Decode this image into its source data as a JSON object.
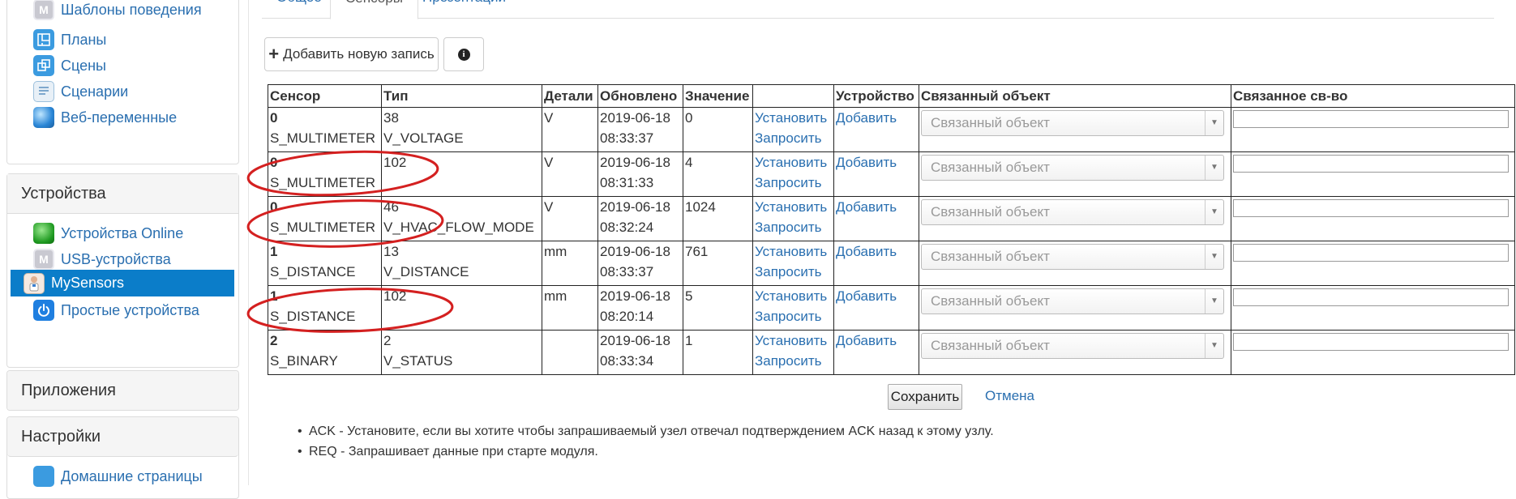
{
  "sidebar": {
    "top_items": [
      {
        "label": "Шаблоны поведения",
        "icon": "behavior-template-icon"
      },
      {
        "label": "Планы",
        "icon": "plans-icon"
      },
      {
        "label": "Сцены",
        "icon": "scenes-icon"
      },
      {
        "label": "Сценарии",
        "icon": "scripts-icon"
      },
      {
        "label": "Веб-переменные",
        "icon": "globe-icon"
      }
    ],
    "devices_header": "Устройства",
    "device_items": [
      {
        "label": "Устройства Online",
        "icon": "online-devices-icon"
      },
      {
        "label": "USB-устройства",
        "icon": "usb-devices-icon"
      },
      {
        "label": "MySensors",
        "icon": "mysensors-icon",
        "active": true
      },
      {
        "label": "Простые устройства",
        "icon": "power-icon"
      }
    ],
    "apps_header": "Приложения",
    "settings_header": "Настройки",
    "settings_partial_item": "Домашние страницы"
  },
  "tabs": [
    {
      "label": "Общее"
    },
    {
      "label": "Сенсоры",
      "active": true
    },
    {
      "label": "Презентации"
    }
  ],
  "toolbar": {
    "add_label": "Добавить новую запись",
    "info_icon": "info-icon"
  },
  "table": {
    "headers": [
      "Сенсор",
      "Тип",
      "Детали",
      "Обновлено",
      "Значение",
      "",
      "Устройство",
      "Связанный объект",
      "Связанное св-во"
    ],
    "rows": [
      {
        "sensor_id": "0",
        "sensor_type": "S_MULTIMETER",
        "type_id": "38",
        "type_name": "V_VOLTAGE",
        "details": "V",
        "date": "2019-06-18",
        "time": "08:33:37",
        "value": "0"
      },
      {
        "sensor_id": "0",
        "sensor_type": "S_MULTIMETER",
        "type_id": "102",
        "type_name": "",
        "details": "V",
        "date": "2019-06-18",
        "time": "08:31:33",
        "value": "4"
      },
      {
        "sensor_id": "0",
        "sensor_type": "S_MULTIMETER",
        "type_id": "46",
        "type_name": "V_HVAC_FLOW_MODE",
        "details": "V",
        "date": "2019-06-18",
        "time": "08:32:24",
        "value": "1024"
      },
      {
        "sensor_id": "1",
        "sensor_type": "S_DISTANCE",
        "type_id": "13",
        "type_name": "V_DISTANCE",
        "details": "mm",
        "date": "2019-06-18",
        "time": "08:33:37",
        "value": "761"
      },
      {
        "sensor_id": "1",
        "sensor_type": "S_DISTANCE",
        "type_id": "102",
        "type_name": "",
        "details": "mm",
        "date": "2019-06-18",
        "time": "08:20:14",
        "value": "5"
      },
      {
        "sensor_id": "2",
        "sensor_type": "S_BINARY",
        "type_id": "2",
        "type_name": "V_STATUS",
        "details": "",
        "date": "2019-06-18",
        "time": "08:33:34",
        "value": "1"
      }
    ],
    "set_link": "Установить",
    "request_link": "Запросить",
    "add_device_link": "Добавить",
    "linked_object_placeholder": "Связанный объект"
  },
  "actions": {
    "save_label": "Сохранить",
    "cancel_label": "Отмена"
  },
  "notes": [
    {
      "term": "ACK",
      "text": " - Установите, если вы хотите чтобы запрашиваемый узел отвечал подтверждением ACK назад к этому узлу."
    },
    {
      "term": "REQ",
      "text": " - Запрашивает данные при старте модуля."
    }
  ],
  "colors": {
    "active_nav": "#0b7dc9",
    "link": "#2a6fb0",
    "annotation": "#d42020"
  }
}
